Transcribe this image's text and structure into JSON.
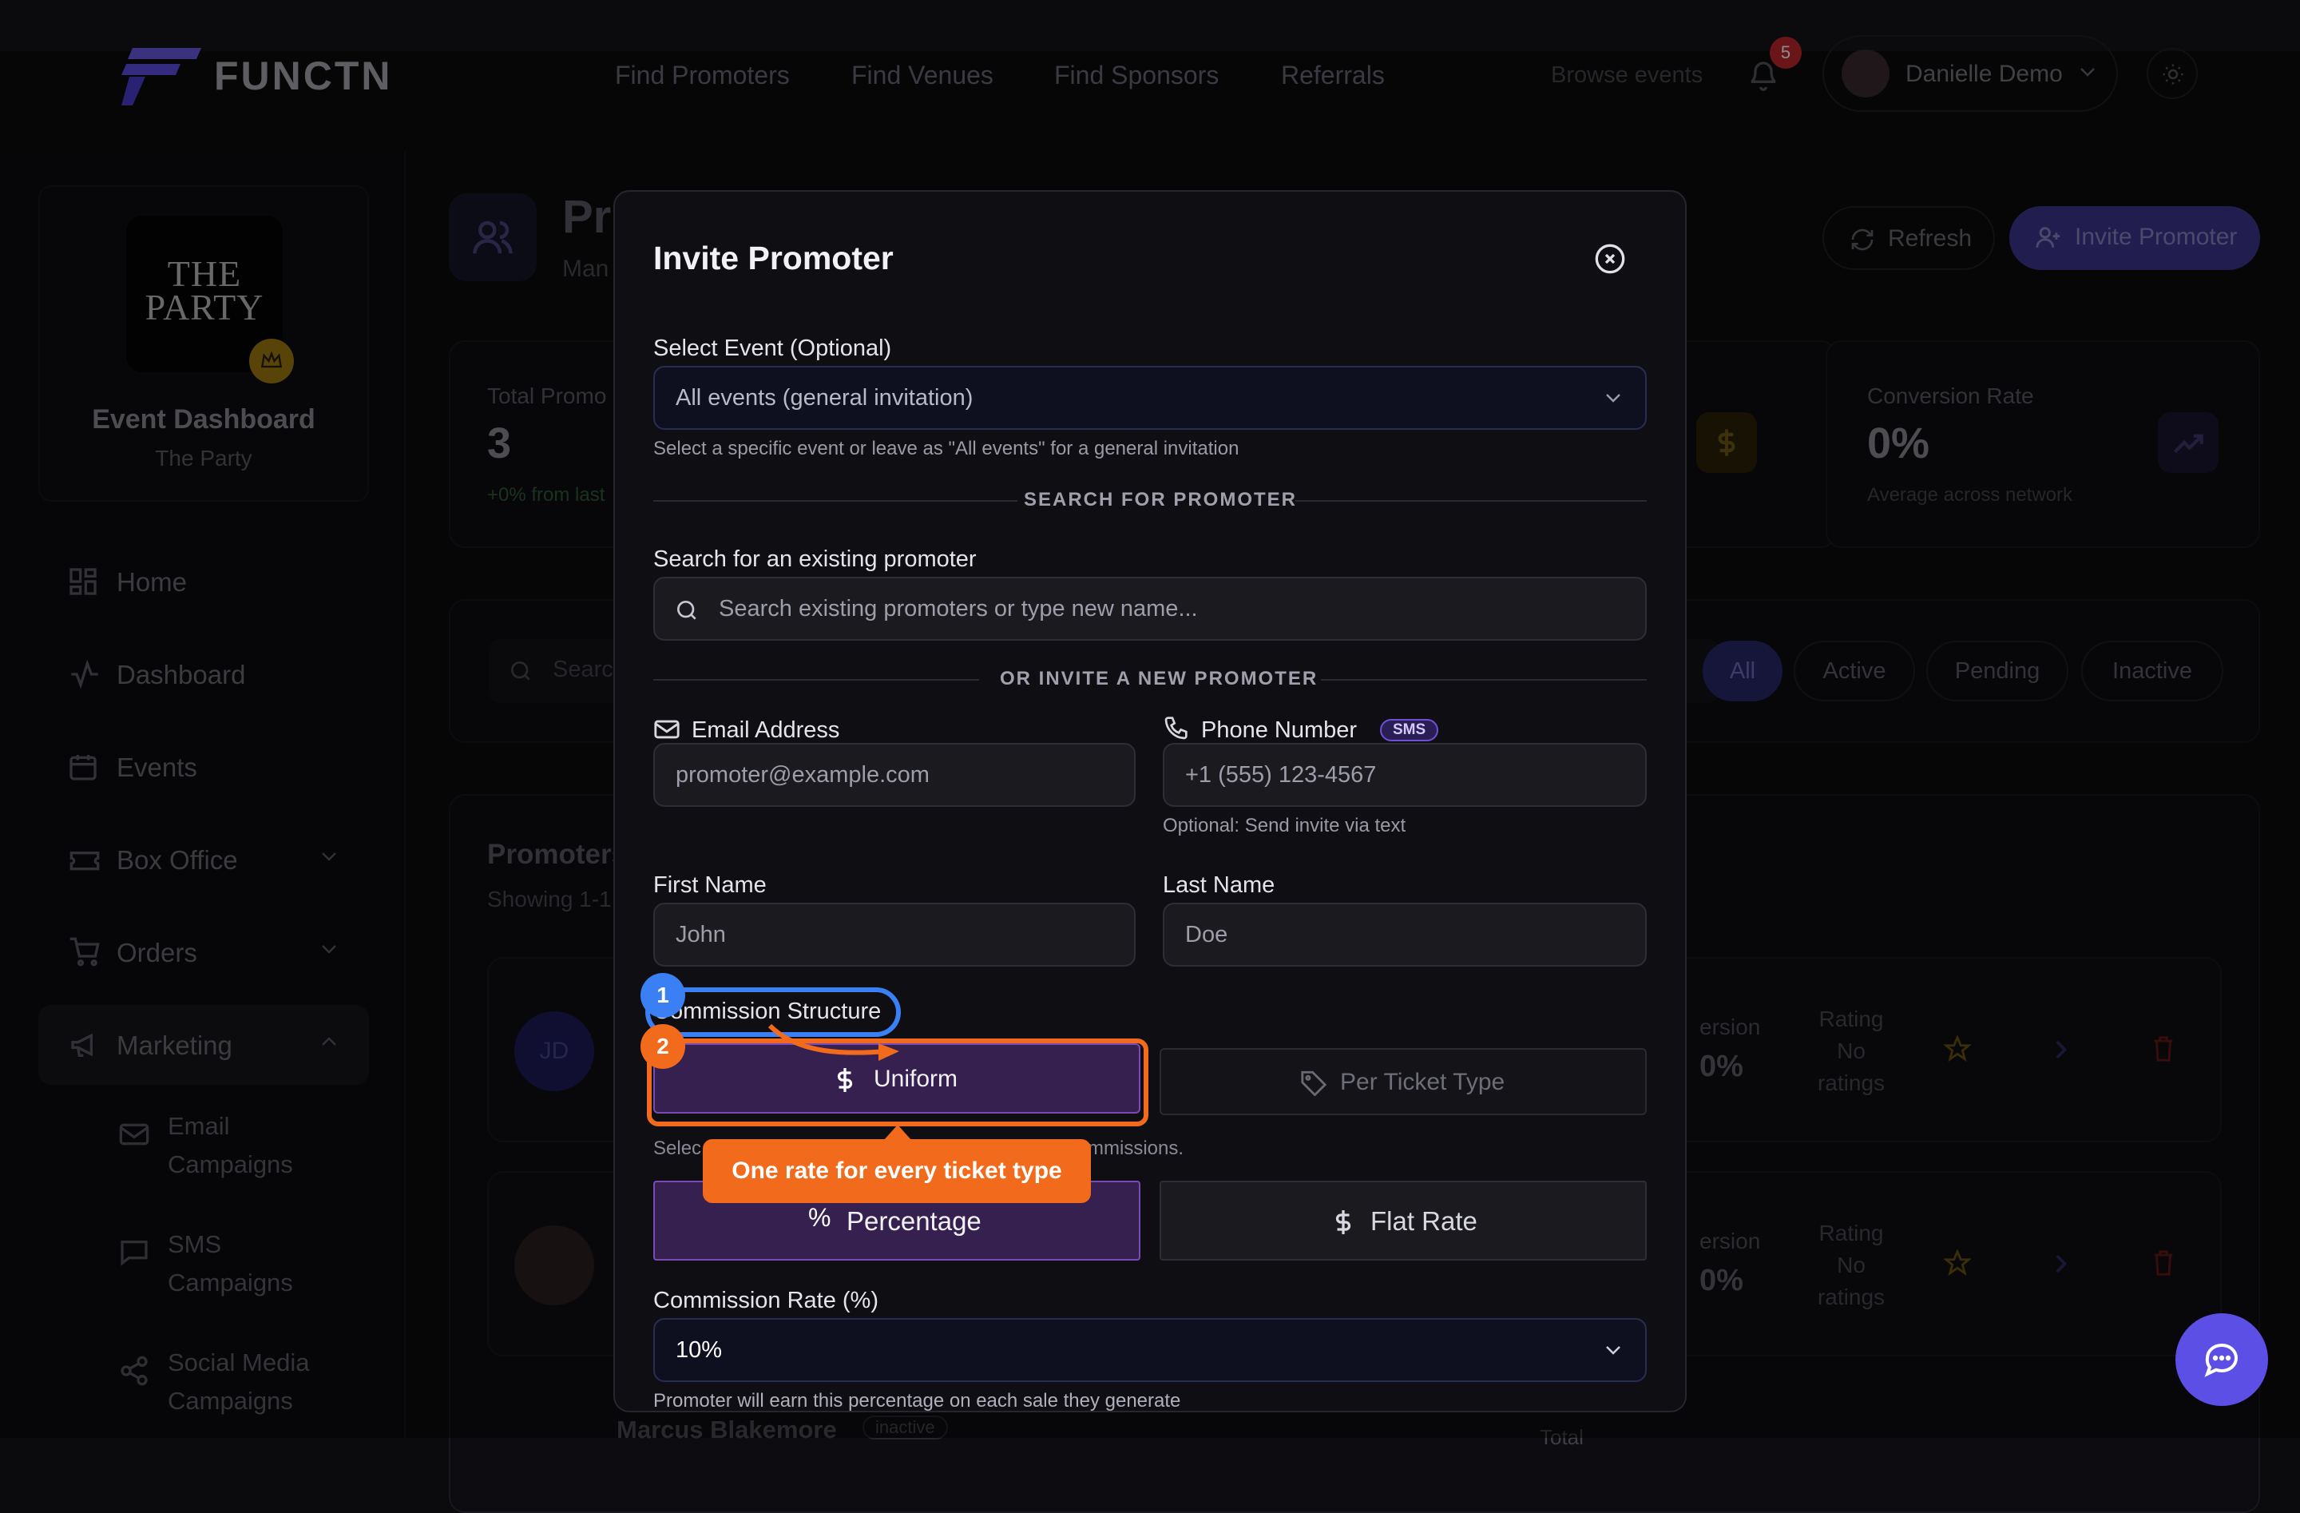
{
  "brand": {
    "name": "FUNCTN"
  },
  "nav": {
    "links": [
      "Find Promoters",
      "Find Venues",
      "Find Sponsors",
      "Referrals"
    ],
    "browse": "Browse events",
    "notification_count": "5",
    "user_name": "Danielle Demo"
  },
  "sidebar": {
    "event_image_text": "THE PARTY",
    "event_title": "Event Dashboard",
    "event_subtitle": "The Party",
    "items": [
      {
        "label": "Home",
        "icon": "grid-icon"
      },
      {
        "label": "Dashboard",
        "icon": "activity-icon"
      },
      {
        "label": "Events",
        "icon": "calendar-icon"
      },
      {
        "label": "Box Office",
        "icon": "ticket-icon"
      },
      {
        "label": "Orders",
        "icon": "cart-icon"
      },
      {
        "label": "Marketing",
        "icon": "megaphone-icon"
      }
    ],
    "subitems": [
      {
        "line1": "Email",
        "line2": "Campaigns",
        "icon": "mail-icon"
      },
      {
        "line1": "SMS",
        "line2": "Campaigns",
        "icon": "message-icon"
      },
      {
        "line1": "Social Media",
        "line2": "Campaigns",
        "icon": "share-icon"
      }
    ]
  },
  "page": {
    "title_partial": "Pr",
    "subtitle_partial": "Man",
    "refresh_label": "Refresh",
    "invite_label": "Invite Promoter",
    "stats": {
      "total_label": "Total Promo",
      "total_value": "3",
      "total_note": "+0% from last",
      "conv_label": "Conversion Rate",
      "conv_value": "0%",
      "conv_note": "Average across network"
    },
    "search_partial": "Searc",
    "filters": [
      "All",
      "Active",
      "Pending",
      "Inactive"
    ],
    "table_title": "Promoters",
    "table_sub": "Showing 1-1",
    "rows": [
      {
        "initials": "JD",
        "conv_label": "ersion",
        "conv_value": "0%",
        "rating_line1": "Rating",
        "rating_line2": "No",
        "rating_line3": "ratings"
      },
      {
        "initials": "",
        "conv_label": "ersion",
        "conv_value": "0%",
        "rating_line1": "Rating",
        "rating_line2": "No",
        "rating_line3": "ratings"
      }
    ],
    "partial_row_name": "Marcus Blakemore",
    "partial_row_status": "inactive",
    "partial_row_total": "Total"
  },
  "modal": {
    "title": "Invite Promoter",
    "event_label": "Select Event (Optional)",
    "event_value": "All events (general invitation)",
    "event_help": "Select a specific event or leave as \"All events\" for a general invitation",
    "search_divider": "SEARCH FOR PROMOTER",
    "search_label": "Search for an existing promoter",
    "search_placeholder": "Search existing promoters or type new name...",
    "invite_divider": "OR INVITE A NEW PROMOTER",
    "email_label": "Email Address",
    "email_placeholder": "promoter@example.com",
    "phone_label": "Phone Number",
    "phone_badge": "SMS",
    "phone_placeholder": "+1 (555) 123-4567",
    "phone_help": "Optional: Send invite via text",
    "first_label": "First Name",
    "first_placeholder": "John",
    "last_label": "Last Name",
    "last_placeholder": "Doe",
    "commission_label": "Commission Structure",
    "uniform_label": "Uniform",
    "per_ticket_label": "Per Ticket Type",
    "structure_help_start": "Selec",
    "structure_help_end": "mmissions.",
    "percentage_label": "Percentage",
    "flat_label": "Flat Rate",
    "rate_label": "Commission Rate (%)",
    "rate_value": "10%",
    "rate_help": "Promoter will earn this percentage on each sale they generate"
  },
  "tutorial": {
    "step1": "1",
    "step2": "2",
    "tooltip": "One rate for every ticket type"
  },
  "colors": {
    "accent": "#5b4fe6",
    "selected_segment": "#35204f",
    "tutorial_orange": "#f26a1b",
    "tutorial_blue": "#3b7ff5"
  }
}
